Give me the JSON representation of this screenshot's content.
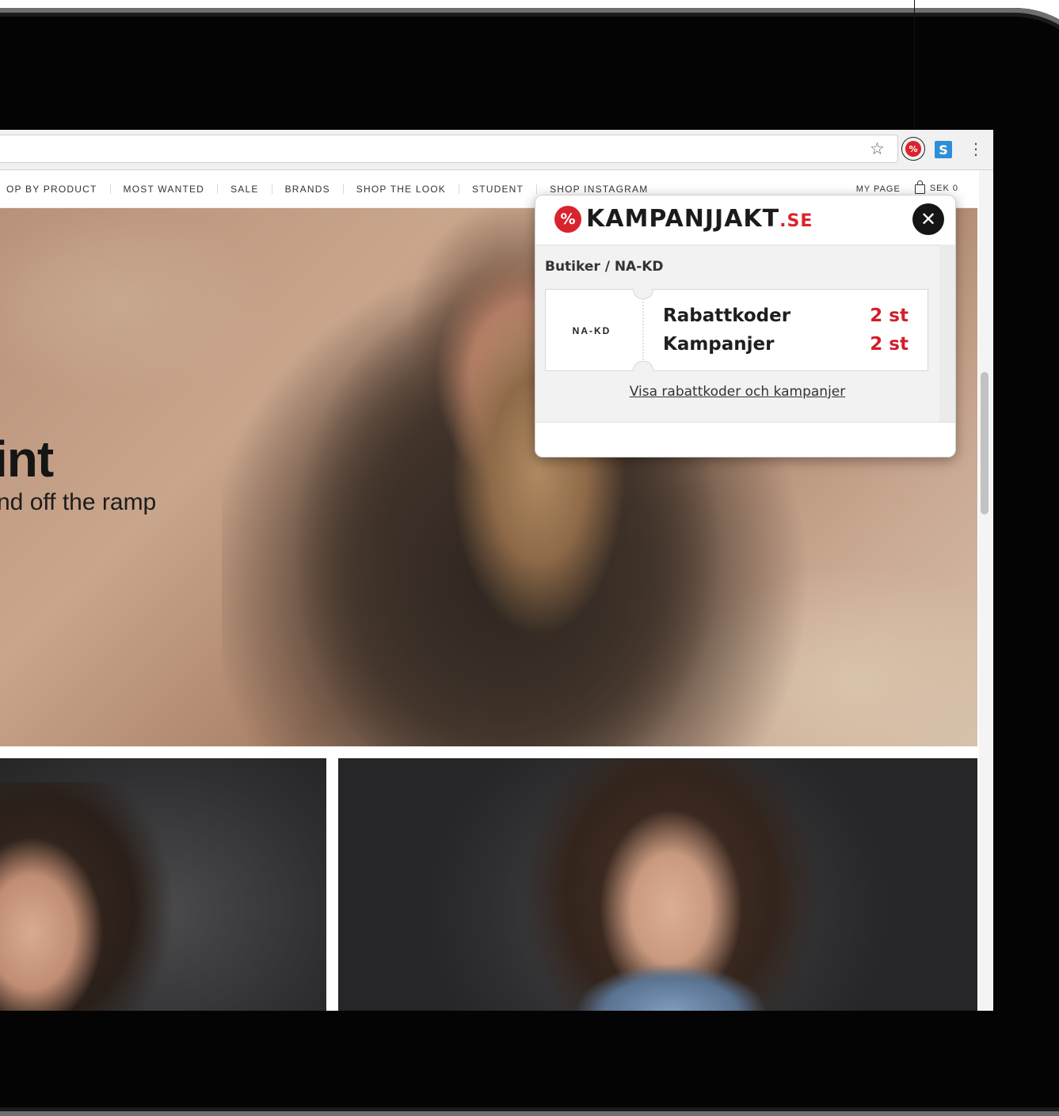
{
  "browser": {
    "star_icon": "star-icon",
    "extension_badge_symbol": "%",
    "extension_secondary_symbol": "S",
    "menu_symbol": "⋮"
  },
  "site_nav": {
    "items": [
      "OP BY PRODUCT",
      "MOST WANTED",
      "SALE",
      "BRANDS",
      "SHOP THE LOOK",
      "STUDENT",
      "SHOP INSTAGRAM"
    ],
    "my_page": "MY PAGE",
    "cart": "SEK 0"
  },
  "hero": {
    "headline": "int",
    "subheadline": "nd off the ramp"
  },
  "popup": {
    "logo_symbol": "%",
    "logo_name": "KAMPANJJAKT",
    "logo_tld": ".SE",
    "close_symbol": "✕",
    "breadcrumb": "Butiker / NA-KD",
    "store_logo_text": "NA-KD",
    "rows": [
      {
        "label": "Rabattkoder",
        "count": "2 st"
      },
      {
        "label": "Kampanjer",
        "count": "2 st"
      }
    ],
    "link": "Visa rabattkoder och kampanjer"
  },
  "colors": {
    "brand_red": "#d9232d",
    "count_red": "#d11f2a",
    "device_black": "#040404"
  }
}
